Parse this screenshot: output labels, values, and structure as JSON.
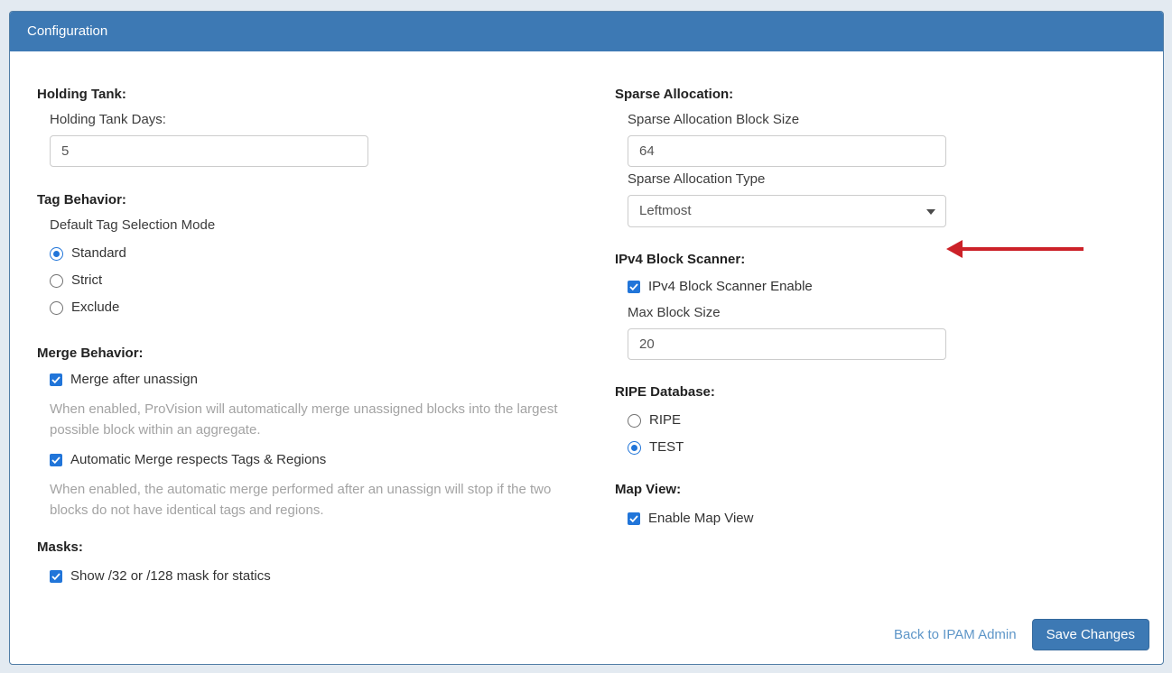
{
  "panel": {
    "title": "Configuration"
  },
  "colors": {
    "header_blue": "#3d79b4",
    "control_blue": "#2175d9",
    "arrow_red": "#cc2128",
    "link_blue": "#5e96c8",
    "panel_border": "#527ea6"
  },
  "left": {
    "holding_tank": {
      "heading": "Holding Tank:",
      "days_label": "Holding Tank Days:",
      "days_value": "5"
    },
    "tag_behavior": {
      "heading": "Tag Behavior:",
      "mode_label": "Default Tag Selection Mode",
      "options": [
        {
          "label": "Standard",
          "selected": true
        },
        {
          "label": "Strict",
          "selected": false
        },
        {
          "label": "Exclude",
          "selected": false
        }
      ]
    },
    "merge_behavior": {
      "heading": "Merge Behavior:",
      "merge_after_unassign": {
        "label": "Merge after unassign",
        "checked": true,
        "help": "When enabled, ProVision will automatically merge unassigned blocks into the largest possible block within an aggregate."
      },
      "respects_tags": {
        "label": "Automatic Merge respects Tags & Regions",
        "checked": true,
        "help": "When enabled, the automatic merge performed after an unassign will stop if the two blocks do not have identical tags and regions."
      }
    },
    "masks": {
      "heading": "Masks:",
      "show_mask": {
        "label": "Show /32 or /128 mask for statics",
        "checked": true
      }
    }
  },
  "right": {
    "sparse_allocation": {
      "heading": "Sparse Allocation:",
      "block_size_label": "Sparse Allocation Block Size",
      "block_size_value": "64",
      "type_label": "Sparse Allocation Type",
      "type_value": "Leftmost"
    },
    "ipv4_scanner": {
      "heading": "IPv4 Block Scanner:",
      "enable": {
        "label": "IPv4 Block Scanner Enable",
        "checked": true
      },
      "max_label": "Max Block Size",
      "max_value": "20"
    },
    "ripe_database": {
      "heading": "RIPE Database:",
      "options": [
        {
          "label": "RIPE",
          "selected": false
        },
        {
          "label": "TEST",
          "selected": true
        }
      ]
    },
    "map_view": {
      "heading": "Map View:",
      "enable": {
        "label": "Enable Map View",
        "checked": true
      }
    }
  },
  "footer": {
    "back_link": "Back to IPAM Admin",
    "save_button": "Save Changes"
  },
  "icons": {
    "checkmark": "checkmark-icon",
    "caret": "chevron-down-icon",
    "arrow": "red-arrow-annotation"
  }
}
